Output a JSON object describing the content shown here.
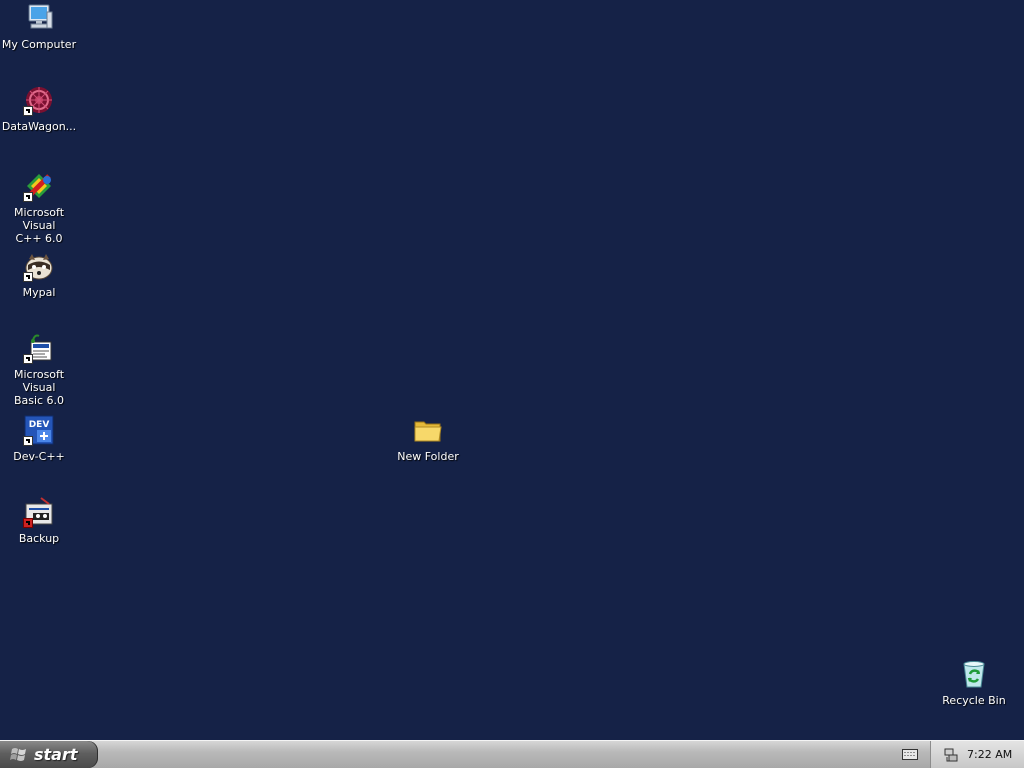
{
  "desktop": {
    "icons": [
      {
        "label": "My Computer",
        "icon": "my-computer-icon"
      },
      {
        "label": "DataWagon...",
        "icon": "datawagon-icon"
      },
      {
        "label": "Microsoft Visual\nC++ 6.0",
        "icon": "visual-cpp-icon"
      },
      {
        "label": "Mypal",
        "icon": "mypal-icon"
      },
      {
        "label": "Microsoft Visual\nBasic 6.0",
        "icon": "visual-basic-icon"
      },
      {
        "label": "Dev-C++",
        "icon": "dev-cpp-icon"
      },
      {
        "label": "Backup",
        "icon": "backup-icon"
      },
      {
        "label": "New Folder",
        "icon": "folder-icon"
      },
      {
        "label": "Recycle Bin",
        "icon": "recycle-bin-icon"
      }
    ],
    "background_color": "#152247"
  },
  "taskbar": {
    "start_label": "start",
    "clock": "7:22 AM"
  }
}
